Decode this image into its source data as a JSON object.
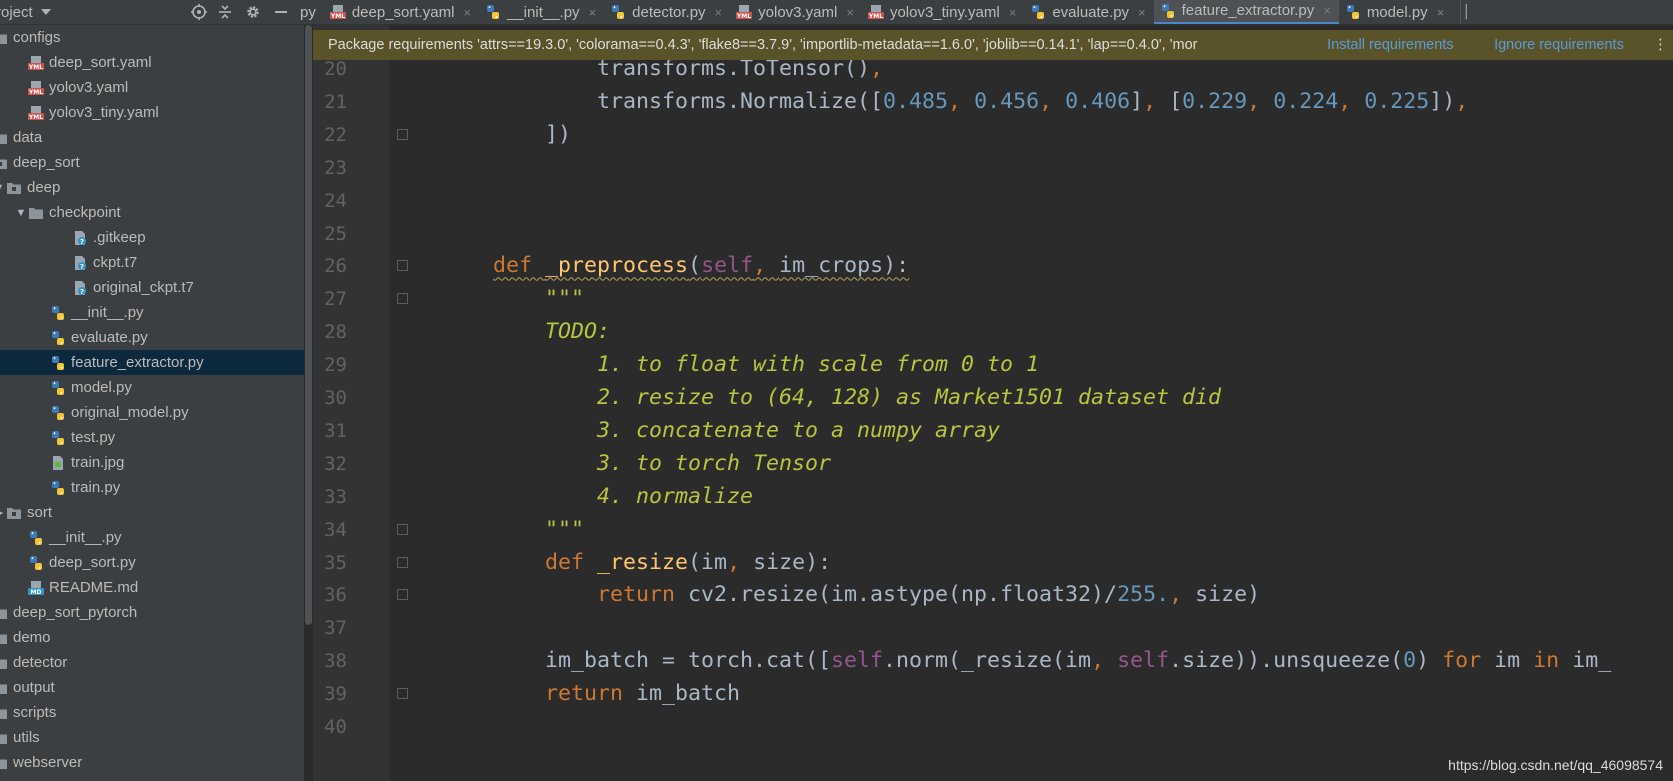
{
  "topbar": {
    "project_title": "roject",
    "icons": [
      "target-icon",
      "collapse-icon",
      "gear-icon",
      "minimize-icon"
    ],
    "tabs": [
      {
        "label": "py",
        "icon": "none",
        "closable": false,
        "active": false
      },
      {
        "label": "deep_sort.yaml",
        "icon": "yaml-icon",
        "closable": true,
        "active": false
      },
      {
        "label": "__init__.py",
        "icon": "python-icon",
        "closable": true,
        "active": false
      },
      {
        "label": "detector.py",
        "icon": "python-icon",
        "closable": true,
        "active": false
      },
      {
        "label": "yolov3.yaml",
        "icon": "yaml-icon",
        "closable": true,
        "active": false
      },
      {
        "label": "yolov3_tiny.yaml",
        "icon": "yaml-icon",
        "closable": true,
        "active": false
      },
      {
        "label": "evaluate.py",
        "icon": "python-icon",
        "closable": true,
        "active": false
      },
      {
        "label": "feature_extractor.py",
        "icon": "python-icon",
        "closable": true,
        "active": true
      },
      {
        "label": "model.py",
        "icon": "python-icon",
        "closable": true,
        "active": false
      }
    ],
    "close_glyph": "×"
  },
  "sidebar": {
    "items": [
      {
        "label": "configs",
        "indent": 0,
        "icon": "folder-icon",
        "arrow": ""
      },
      {
        "label": "deep_sort.yaml",
        "indent": 1,
        "icon": "yaml-icon",
        "arrow": ""
      },
      {
        "label": "yolov3.yaml",
        "indent": 1,
        "icon": "yaml-icon",
        "arrow": ""
      },
      {
        "label": "yolov3_tiny.yaml",
        "indent": 1,
        "icon": "yaml-icon",
        "arrow": ""
      },
      {
        "label": "data",
        "indent": 0,
        "icon": "folder-icon",
        "arrow": ""
      },
      {
        "label": "deep_sort",
        "indent": 0,
        "icon": "package-icon",
        "arrow": ""
      },
      {
        "label": "deep",
        "indent": 0,
        "icon": "package-icon",
        "arrow": "▼"
      },
      {
        "label": "checkpoint",
        "indent": 1,
        "icon": "folder-icon",
        "arrow": "▼"
      },
      {
        "label": ".gitkeep",
        "indent": 3,
        "icon": "unknown-file-icon",
        "arrow": ""
      },
      {
        "label": "ckpt.t7",
        "indent": 3,
        "icon": "unknown-file-icon",
        "arrow": ""
      },
      {
        "label": "original_ckpt.t7",
        "indent": 3,
        "icon": "unknown-file-icon",
        "arrow": ""
      },
      {
        "label": "__init__.py",
        "indent": 2,
        "icon": "python-icon",
        "arrow": ""
      },
      {
        "label": "evaluate.py",
        "indent": 2,
        "icon": "python-icon",
        "arrow": ""
      },
      {
        "label": "feature_extractor.py",
        "indent": 2,
        "icon": "python-icon",
        "arrow": "",
        "selected": true
      },
      {
        "label": "model.py",
        "indent": 2,
        "icon": "python-icon",
        "arrow": ""
      },
      {
        "label": "original_model.py",
        "indent": 2,
        "icon": "python-icon",
        "arrow": ""
      },
      {
        "label": "test.py",
        "indent": 2,
        "icon": "python-icon",
        "arrow": ""
      },
      {
        "label": "train.jpg",
        "indent": 2,
        "icon": "image-icon",
        "arrow": ""
      },
      {
        "label": "train.py",
        "indent": 2,
        "icon": "python-icon",
        "arrow": ""
      },
      {
        "label": "sort",
        "indent": 0,
        "icon": "package-icon",
        "arrow": "▶"
      },
      {
        "label": "__init__.py",
        "indent": 1,
        "icon": "python-icon",
        "arrow": ""
      },
      {
        "label": "deep_sort.py",
        "indent": 1,
        "icon": "python-icon",
        "arrow": ""
      },
      {
        "label": "README.md",
        "indent": 1,
        "icon": "markdown-icon",
        "arrow": ""
      },
      {
        "label": "deep_sort_pytorch",
        "indent": 0,
        "icon": "folder-icon",
        "arrow": ""
      },
      {
        "label": "demo",
        "indent": 0,
        "icon": "folder-icon",
        "arrow": ""
      },
      {
        "label": "detector",
        "indent": 0,
        "icon": "folder-icon",
        "arrow": ""
      },
      {
        "label": "output",
        "indent": 0,
        "icon": "folder-icon",
        "arrow": ""
      },
      {
        "label": "scripts",
        "indent": 0,
        "icon": "folder-icon",
        "arrow": ""
      },
      {
        "label": "utils",
        "indent": 0,
        "icon": "folder-icon",
        "arrow": ""
      },
      {
        "label": "webserver",
        "indent": 0,
        "icon": "folder-icon",
        "arrow": ""
      }
    ]
  },
  "banner": {
    "text": "Package requirements 'attrs==19.3.0', 'colorama==0.4.3', 'flake8==3.7.9', 'importlib-metadata==1.6.0', 'joblib==0.14.1', 'lap==0.4.0', 'mor",
    "install_label": "Install requirements",
    "ignore_label": "Ignore requirements",
    "more_label": "⋮"
  },
  "editor": {
    "lines": [
      {
        "num": "20",
        "fold": false,
        "tokens": [
          {
            "t": "            transforms.ToTensor()",
            "c": ""
          },
          {
            "t": ",",
            "c": "kw"
          }
        ]
      },
      {
        "num": "21",
        "fold": false,
        "tokens": [
          {
            "t": "            transforms.Normalize([",
            "c": ""
          },
          {
            "t": "0.485",
            "c": "num"
          },
          {
            "t": ", ",
            "c": "kw"
          },
          {
            "t": "0.456",
            "c": "num"
          },
          {
            "t": ", ",
            "c": "kw"
          },
          {
            "t": "0.406",
            "c": "num"
          },
          {
            "t": "]",
            "c": ""
          },
          {
            "t": ", ",
            "c": "kw"
          },
          {
            "t": "[",
            "c": ""
          },
          {
            "t": "0.229",
            "c": "num"
          },
          {
            "t": ", ",
            "c": "kw"
          },
          {
            "t": "0.224",
            "c": "num"
          },
          {
            "t": ", ",
            "c": "kw"
          },
          {
            "t": "0.225",
            "c": "num"
          },
          {
            "t": "])",
            "c": ""
          },
          {
            "t": ",",
            "c": "kw"
          }
        ]
      },
      {
        "num": "22",
        "fold": true,
        "tokens": [
          {
            "t": "        ])",
            "c": ""
          }
        ]
      },
      {
        "num": "23",
        "fold": false,
        "tokens": []
      },
      {
        "num": "24",
        "fold": false,
        "tokens": []
      },
      {
        "num": "25",
        "fold": false,
        "tokens": []
      },
      {
        "num": "26",
        "fold": true,
        "tokens": [
          {
            "t": "    ",
            "c": ""
          },
          {
            "t": "def ",
            "c": "kw wavy"
          },
          {
            "t": "_preprocess",
            "c": "fn wavy"
          },
          {
            "t": "(",
            "c": "wavy"
          },
          {
            "t": "self",
            "c": "self wavy"
          },
          {
            "t": ", ",
            "c": "kw wavy"
          },
          {
            "t": "im_crops):",
            "c": "wavy"
          }
        ]
      },
      {
        "num": "27",
        "fold": true,
        "tokens": [
          {
            "t": "        ",
            "c": ""
          },
          {
            "t": "\"\"\"",
            "c": "doc"
          }
        ]
      },
      {
        "num": "28",
        "fold": false,
        "tokens": [
          {
            "t": "        ",
            "c": ""
          },
          {
            "t": "TODO:",
            "c": "doc"
          }
        ]
      },
      {
        "num": "29",
        "fold": false,
        "tokens": [
          {
            "t": "            ",
            "c": ""
          },
          {
            "t": "1. to float with scale from 0 to 1",
            "c": "doc"
          }
        ]
      },
      {
        "num": "30",
        "fold": false,
        "tokens": [
          {
            "t": "            ",
            "c": ""
          },
          {
            "t": "2. resize to (64, 128) as Market1501 dataset did",
            "c": "doc"
          }
        ]
      },
      {
        "num": "31",
        "fold": false,
        "tokens": [
          {
            "t": "            ",
            "c": ""
          },
          {
            "t": "3. concatenate to a numpy array",
            "c": "doc"
          }
        ]
      },
      {
        "num": "32",
        "fold": false,
        "tokens": [
          {
            "t": "            ",
            "c": ""
          },
          {
            "t": "3. to torch Tensor",
            "c": "doc"
          }
        ]
      },
      {
        "num": "33",
        "fold": false,
        "tokens": [
          {
            "t": "            ",
            "c": ""
          },
          {
            "t": "4. normalize",
            "c": "doc"
          }
        ]
      },
      {
        "num": "34",
        "fold": true,
        "tokens": [
          {
            "t": "        ",
            "c": ""
          },
          {
            "t": "\"\"\"",
            "c": "doc"
          }
        ]
      },
      {
        "num": "35",
        "fold": true,
        "tokens": [
          {
            "t": "        ",
            "c": ""
          },
          {
            "t": "def ",
            "c": "kw"
          },
          {
            "t": "_resize",
            "c": "fn"
          },
          {
            "t": "(im",
            "c": ""
          },
          {
            "t": ", ",
            "c": "kw"
          },
          {
            "t": "size):",
            "c": ""
          }
        ]
      },
      {
        "num": "36",
        "fold": true,
        "tokens": [
          {
            "t": "            ",
            "c": ""
          },
          {
            "t": "return ",
            "c": "kw"
          },
          {
            "t": "cv2.resize(im.astype(np.float32)/",
            "c": ""
          },
          {
            "t": "255.",
            "c": "num"
          },
          {
            "t": ", ",
            "c": "kw"
          },
          {
            "t": "size)",
            "c": ""
          }
        ]
      },
      {
        "num": "37",
        "fold": false,
        "tokens": []
      },
      {
        "num": "38",
        "fold": false,
        "tokens": [
          {
            "t": "        im_batch = torch.cat([",
            "c": ""
          },
          {
            "t": "self",
            "c": "self"
          },
          {
            "t": ".norm(_resize(im",
            "c": ""
          },
          {
            "t": ", ",
            "c": "kw"
          },
          {
            "t": "self",
            "c": "self"
          },
          {
            "t": ".size)).unsqueeze(",
            "c": ""
          },
          {
            "t": "0",
            "c": "num"
          },
          {
            "t": ") ",
            "c": ""
          },
          {
            "t": "for ",
            "c": "kw"
          },
          {
            "t": "im ",
            "c": ""
          },
          {
            "t": "in ",
            "c": "kw"
          },
          {
            "t": "im_",
            "c": ""
          }
        ]
      },
      {
        "num": "39",
        "fold": true,
        "tokens": [
          {
            "t": "        ",
            "c": ""
          },
          {
            "t": "return ",
            "c": "kw"
          },
          {
            "t": "im_batch",
            "c": ""
          }
        ]
      },
      {
        "num": "40",
        "fold": false,
        "tokens": []
      }
    ]
  },
  "watermark": "https://blog.csdn.net/qq_46098574",
  "colors": {
    "accent": "#4a88c7",
    "selection": "#0d293e",
    "banner_bg": "#5a5329",
    "keyword": "#cc7832",
    "function": "#ffc66d",
    "number": "#6897bb",
    "docstring": "#b8c63e",
    "self": "#94558d"
  }
}
